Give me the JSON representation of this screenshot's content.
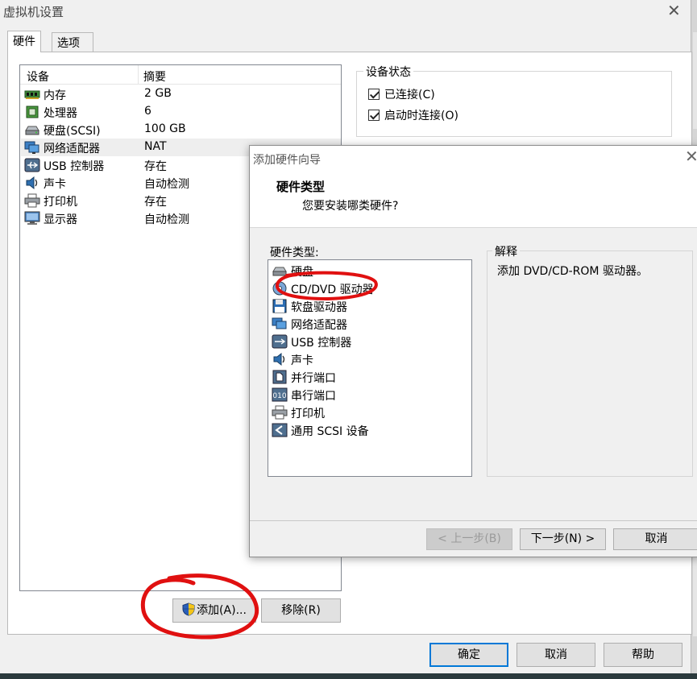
{
  "window": {
    "title": "虚拟机设置"
  },
  "tabs": [
    {
      "label": "硬件",
      "active": true
    },
    {
      "label": "选项",
      "active": false
    }
  ],
  "device_table": {
    "columns": [
      "设备",
      "摘要"
    ],
    "rows": [
      {
        "icon": "memory-icon",
        "name": "内存",
        "summary": "2 GB"
      },
      {
        "icon": "processor-icon",
        "name": "处理器",
        "summary": "6"
      },
      {
        "icon": "hard-disk-icon",
        "name": "硬盘(SCSI)",
        "summary": "100 GB"
      },
      {
        "icon": "network-adapter-icon",
        "name": "网络适配器",
        "summary": "NAT",
        "selected": true
      },
      {
        "icon": "usb-controller-icon",
        "name": "USB 控制器",
        "summary": "存在"
      },
      {
        "icon": "sound-card-icon",
        "name": "声卡",
        "summary": "自动检测"
      },
      {
        "icon": "printer-icon",
        "name": "打印机",
        "summary": "存在"
      },
      {
        "icon": "display-icon",
        "name": "显示器",
        "summary": "自动检测"
      }
    ]
  },
  "device_status": {
    "legend": "设备状态",
    "connected": {
      "label": "已连接(C)",
      "checked": true
    },
    "connect_at_power_on": {
      "label": "启动时连接(O)",
      "checked": true
    }
  },
  "list_buttons": {
    "add": "添加(A)...",
    "remove": "移除(R)"
  },
  "footer_buttons": {
    "ok": "确定",
    "cancel": "取消",
    "help": "帮助"
  },
  "wizard": {
    "title": "添加硬件向导",
    "heading": "硬件类型",
    "subheading": "您要安装哪类硬件?",
    "list_label": "硬件类型:",
    "hardware_types": [
      {
        "icon": "hard-disk-icon",
        "label": "硬盘"
      },
      {
        "icon": "cd-dvd-icon",
        "label": "CD/DVD 驱动器"
      },
      {
        "icon": "floppy-icon",
        "label": "软盘驱动器"
      },
      {
        "icon": "network-adapter-icon",
        "label": "网络适配器"
      },
      {
        "icon": "usb-controller-icon",
        "label": "USB 控制器"
      },
      {
        "icon": "sound-card-icon",
        "label": "声卡"
      },
      {
        "icon": "parallel-port-icon",
        "label": "并行端口"
      },
      {
        "icon": "serial-port-icon",
        "label": "串行端口"
      },
      {
        "icon": "printer-icon",
        "label": "打印机"
      },
      {
        "icon": "scsi-device-icon",
        "label": "通用 SCSI 设备"
      }
    ],
    "explanation_legend": "解释",
    "explanation_text": "添加 DVD/CD-ROM 驱动器。",
    "buttons": {
      "back": "< 上一步(B)",
      "next": "下一步(N) >",
      "cancel": "取消"
    }
  },
  "colors": {
    "annotation_red": "#e01010",
    "focus_blue": "#0078d7",
    "selection_gray": "#eeeeee"
  }
}
